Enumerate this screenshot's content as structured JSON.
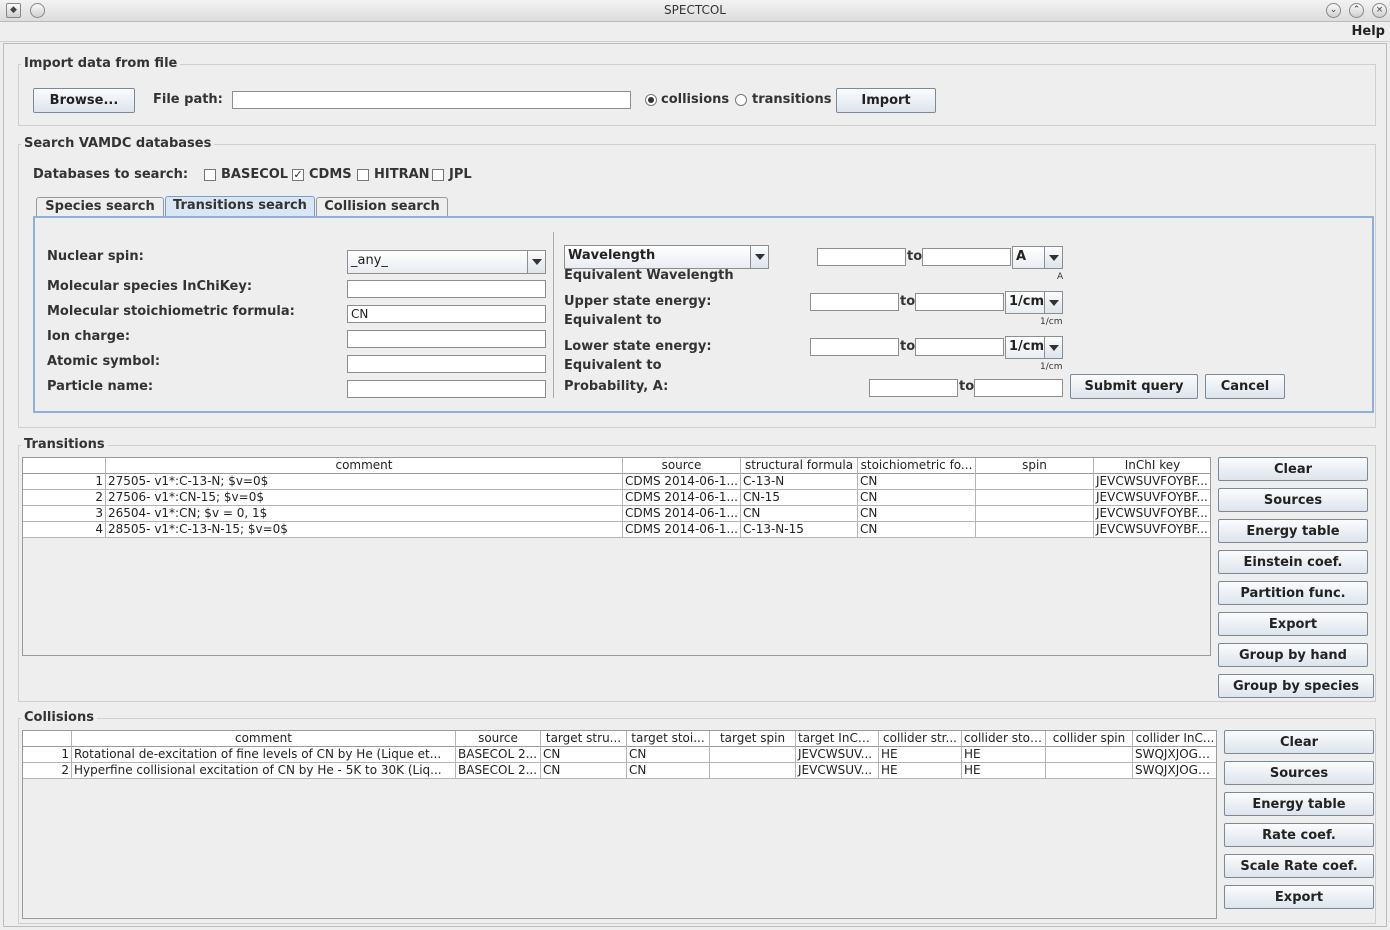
{
  "window": {
    "title": "SPECTCOL"
  },
  "menu": {
    "help": "Help"
  },
  "import": {
    "legend": "Import data from file",
    "browse": "Browse...",
    "file_path_label": "File path:",
    "file_path_value": "",
    "radio_collisions": "collisions",
    "radio_transitions": "transitions",
    "selected": "collisions",
    "import_button": "Import"
  },
  "search": {
    "legend": "Search VAMDC databases",
    "databases_label": "Databases to search:",
    "databases": [
      {
        "label": "BASECOL",
        "checked": false
      },
      {
        "label": "CDMS",
        "checked": true
      },
      {
        "label": "HITRAN",
        "checked": false
      },
      {
        "label": "JPL",
        "checked": false
      }
    ],
    "tabs": [
      {
        "label": "Species search",
        "selected": false
      },
      {
        "label": "Transitions search",
        "selected": true
      },
      {
        "label": "Collision search",
        "selected": false
      }
    ],
    "form": {
      "nuclear_spin_label": "Nuclear spin:",
      "nuclear_spin_value": "_any_",
      "inchikey_label": "Molecular species InChiKey:",
      "inchikey_value": "",
      "formula_label": "Molecular stoichiometric formula:",
      "formula_value": "CN",
      "ion_charge_label": "Ion charge:",
      "ion_charge_value": "",
      "atomic_symbol_label": "Atomic symbol:",
      "atomic_symbol_value": "",
      "particle_name_label": "Particle name:",
      "particle_name_value": ""
    },
    "range": {
      "wavelength_select": "Wavelength",
      "equivalent_wavelength": "Equivalent Wavelength",
      "wavelength_unit": "A",
      "wavelength_unit_small": "A",
      "to": "to",
      "upper_label": "Upper state energy:",
      "upper_equiv": "Equivalent to",
      "upper_unit": "1/cm",
      "upper_unit_small": "1/cm",
      "lower_label": "Lower state energy:",
      "lower_equiv": "Equivalent to",
      "lower_unit": "1/cm",
      "lower_unit_small": "1/cm",
      "probability_label": "Probability, A:",
      "submit": "Submit query",
      "cancel": "Cancel"
    }
  },
  "transitions": {
    "legend": "Transitions",
    "columns": [
      "",
      "comment",
      "source",
      "structural formula",
      "stoichiometric fo...",
      "spin",
      "InChI key"
    ],
    "rows": [
      [
        "1",
        "27505- v1*:C-13-N; $v=0$",
        "CDMS 2014-06-1...",
        "C-13-N",
        "CN",
        "",
        "JEVCWSUVFOYBF..."
      ],
      [
        "2",
        "27506- v1*:CN-15; $v=0$",
        "CDMS 2014-06-1...",
        "CN-15",
        "CN",
        "",
        "JEVCWSUVFOYBF..."
      ],
      [
        "3",
        "26504- v1*:CN; $v = 0, 1$",
        "CDMS 2014-06-1...",
        "CN",
        "CN",
        "",
        "JEVCWSUVFOYBF..."
      ],
      [
        "4",
        "28505- v1*:C-13-N-15; $v=0$",
        "CDMS 2014-06-1...",
        "C-13-N-15",
        "CN",
        "",
        "JEVCWSUVFOYBF..."
      ]
    ],
    "buttons": [
      "Clear",
      "Sources",
      "Energy table",
      "Einstein coef.",
      "Partition func.",
      "Export",
      "Group by hand",
      "Group by species"
    ]
  },
  "collisions": {
    "legend": "Collisions",
    "columns": [
      "",
      "comment",
      "source",
      "target stru...",
      "target stoi...",
      "target spin",
      "target InCh...",
      "collider str...",
      "collider stoi...",
      "collider spin",
      "collider InC..."
    ],
    "rows": [
      [
        "1",
        "Rotational de-excitation of fine levels of CN by He (Lique et...",
        "BASECOL 2...",
        "CN",
        "CN",
        "",
        "JEVCWSUV...",
        "HE",
        "HE",
        "",
        "SWQJXJOGL..."
      ],
      [
        "2",
        "Hyperfine collisional excitation of CN by He - 5K to 30K (Liq...",
        "BASECOL 2...",
        "CN",
        "CN",
        "",
        "JEVCWSUV...",
        "HE",
        "HE",
        "",
        "SWQJXJOGL..."
      ]
    ],
    "buttons": [
      "Clear",
      "Sources",
      "Energy table",
      "Rate coef.",
      "Scale Rate coef.",
      "Export"
    ]
  }
}
